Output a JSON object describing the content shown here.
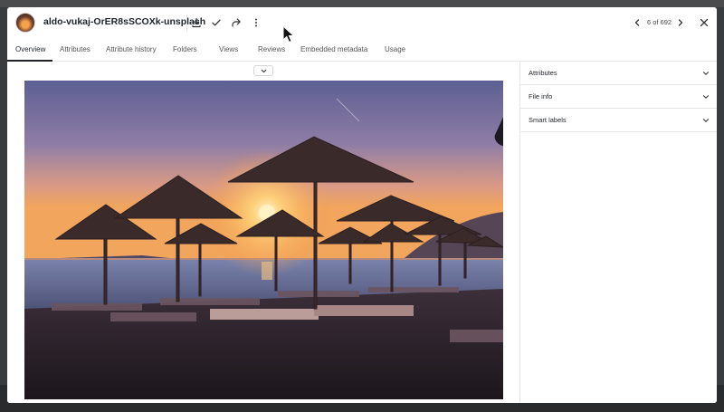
{
  "header": {
    "title": "aldo-vukaj-OrER8sSCOXk-unsplash",
    "pager": "6 of 692"
  },
  "tabs": [
    {
      "label": "Overview"
    },
    {
      "label": "Attributes"
    },
    {
      "label": "Attribute history"
    },
    {
      "label": "Folders"
    },
    {
      "label": "Views"
    },
    {
      "label": "Reviews"
    },
    {
      "label": "Embedded metadata"
    },
    {
      "label": "Usage"
    }
  ],
  "active_tab": "Overview",
  "panel": {
    "sections": [
      {
        "label": "Attributes"
      },
      {
        "label": "File info"
      },
      {
        "label": "Smart labels"
      }
    ]
  },
  "icons": {
    "download": "download-icon",
    "approve": "check-icon",
    "share": "share-icon",
    "more": "more-vertical-icon",
    "prev": "chevron-left-icon",
    "next": "chevron-right-icon",
    "close": "close-icon",
    "collapse": "chevron-down-icon"
  },
  "colors": {
    "accent": "#1f2328",
    "border": "#e6e6e6"
  }
}
